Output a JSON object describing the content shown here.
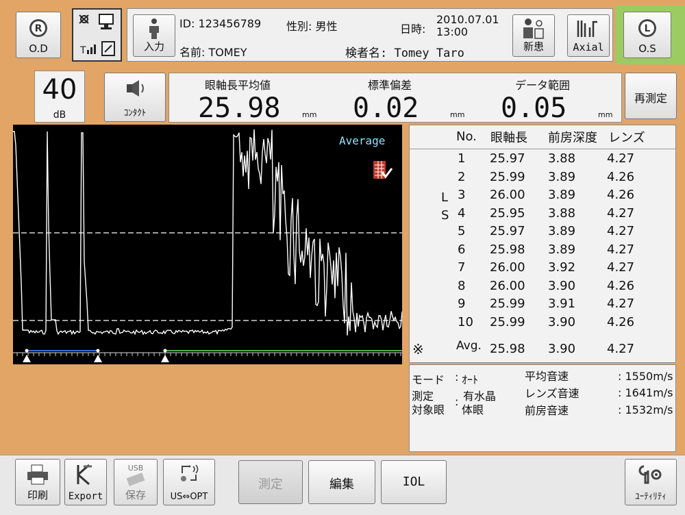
{
  "header": {
    "od_button": {
      "letter": "R",
      "label": "O.D"
    },
    "os_button": {
      "letter": "L",
      "label": "O.S"
    },
    "input_button": {
      "label": "入力"
    },
    "patient": {
      "id": "ID: 123456789",
      "sex": "性別: 男性",
      "name": "名前: TOMEY",
      "datetime_label": "日時:",
      "date": "2010.07.01",
      "time": "13:00",
      "examiner": "検者名: Tomey Taro"
    },
    "new_patient_button": {
      "label": "新患"
    },
    "axial_button": {
      "label": "Axial"
    }
  },
  "gain": {
    "value": "40",
    "unit": "dB"
  },
  "contact_button": {
    "label": "ｺﾝﾀｸﾄ"
  },
  "summary": {
    "mean": {
      "label": "眼軸長平均値",
      "value": "25.98",
      "unit": "mm"
    },
    "sd": {
      "label": "標準偏差",
      "value": "0.02",
      "unit": "mm"
    },
    "range": {
      "label": "データ範囲",
      "value": "0.05",
      "unit": "mm"
    }
  },
  "remeasure_button": {
    "label": "再測定"
  },
  "waveform": {
    "overlay_label": "Average"
  },
  "table": {
    "headers": [
      "No.",
      "眼軸長",
      "前房深度",
      "レンズ"
    ],
    "side_marks": {
      "row3": "L",
      "row4": "S",
      "avg": "※"
    },
    "rows": [
      {
        "no": "1",
        "axial": "25.97",
        "acd": "3.88",
        "lens": "4.27"
      },
      {
        "no": "2",
        "axial": "25.99",
        "acd": "3.89",
        "lens": "4.26"
      },
      {
        "no": "3",
        "axial": "26.00",
        "acd": "3.89",
        "lens": "4.26"
      },
      {
        "no": "4",
        "axial": "25.95",
        "acd": "3.88",
        "lens": "4.27"
      },
      {
        "no": "5",
        "axial": "25.97",
        "acd": "3.89",
        "lens": "4.27"
      },
      {
        "no": "6",
        "axial": "25.98",
        "acd": "3.89",
        "lens": "4.27"
      },
      {
        "no": "7",
        "axial": "26.00",
        "acd": "3.92",
        "lens": "4.27"
      },
      {
        "no": "8",
        "axial": "26.00",
        "acd": "3.90",
        "lens": "4.26"
      },
      {
        "no": "9",
        "axial": "25.99",
        "acd": "3.91",
        "lens": "4.27"
      },
      {
        "no": "10",
        "axial": "25.99",
        "acd": "3.90",
        "lens": "4.26"
      }
    ],
    "avg": {
      "no": "Avg.",
      "axial": "25.98",
      "acd": "3.90",
      "lens": "4.27"
    }
  },
  "settings": {
    "mode_label": "モード",
    "mode_value": "ｵｰﾄ",
    "target_label1": "測定",
    "target_label2": "対象眼",
    "target_value1": "有水晶",
    "target_value2": "体眼",
    "mean_velocity_label": "平均音速",
    "mean_velocity_value": ": 1550m/s",
    "lens_velocity_label": "レンズ音速",
    "lens_velocity_value": ": 1641m/s",
    "ac_velocity_label": "前房音速",
    "ac_velocity_value": ": 1532m/s"
  },
  "footer": {
    "print": "印刷",
    "export": "Export",
    "save": "保存",
    "usb": "USB",
    "us_opt": "US⇔OPT",
    "measure": "測定",
    "edit": "編集",
    "iol": "IOL",
    "utility": "ﾕｰﾃｨﾘﾃｨ"
  },
  "colors": {
    "background": "#e2a566",
    "os_highlight": "#9ccb62",
    "waveform_bg": "#000000",
    "overlay_text": "#8fe3ff",
    "gate_blue": "#3a6fd8",
    "gate_green": "#4faf4f"
  }
}
